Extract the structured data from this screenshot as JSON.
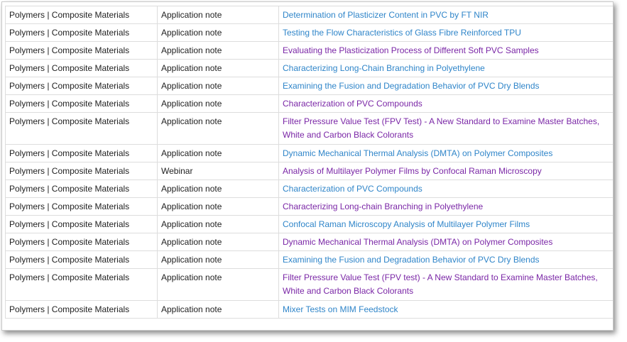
{
  "rows": [
    {
      "category": "Polymers | Composite Materials",
      "type": "Application note",
      "title": "Determination of Plasticizer Content in PVC by FT NIR",
      "visited": false
    },
    {
      "category": "Polymers | Composite Materials",
      "type": "Application note",
      "title": "Testing the Flow Characteristics of Glass Fibre Reinforced TPU",
      "visited": false
    },
    {
      "category": "Polymers | Composite Materials",
      "type": "Application note",
      "title": "Evaluating the Plasticization Process of Different Soft PVC Samples",
      "visited": true
    },
    {
      "category": "Polymers | Composite Materials",
      "type": "Application note",
      "title": "Characterizing Long-Chain Branching in Polyethylene",
      "visited": false
    },
    {
      "category": "Polymers | Composite Materials",
      "type": "Application note",
      "title": "Examining the Fusion and Degradation Behavior of PVC Dry Blends",
      "visited": false
    },
    {
      "category": "Polymers | Composite Materials",
      "type": "Application note",
      "title": "Characterization of PVC Compounds",
      "visited": true
    },
    {
      "category": "Polymers | Composite Materials",
      "type": "Application note",
      "title": "Filter Pressure Value Test (FPV Test) - A New Standard to Examine Master Batches, White and Carbon Black Colorants",
      "visited": true
    },
    {
      "category": "Polymers | Composite Materials",
      "type": "Application note",
      "title": "Dynamic Mechanical Thermal Analysis (DMTA) on Polymer Composites",
      "visited": false
    },
    {
      "category": "Polymers | Composite Materials",
      "type": "Webinar",
      "title": "Analysis of Multilayer Polymer Films by Confocal Raman Microscopy",
      "visited": true
    },
    {
      "category": "Polymers | Composite Materials",
      "type": "Application note",
      "title": "Characterization of PVC Compounds",
      "visited": false
    },
    {
      "category": "Polymers | Composite Materials",
      "type": "Application note",
      "title": "Characterizing Long-chain Branching in Polyethylene",
      "visited": true
    },
    {
      "category": "Polymers | Composite Materials",
      "type": "Application note",
      "title": "Confocal Raman Microscopy Analysis of Multilayer Polymer Films",
      "visited": false
    },
    {
      "category": "Polymers | Composite Materials",
      "type": "Application note",
      "title": "Dynamic Mechanical Thermal Analysis (DMTA) on Polymer Composites",
      "visited": true
    },
    {
      "category": "Polymers | Composite Materials",
      "type": "Application note",
      "title": "Examining the Fusion and Degradation Behavior of PVC Dry Blends",
      "visited": false
    },
    {
      "category": "Polymers | Composite Materials",
      "type": "Application note",
      "title": "Filter Pressure Value Test (FPV test) - A New Standard to Examine Master Batches, White and Carbon Black Colorants",
      "visited": true
    },
    {
      "category": "Polymers | Composite Materials",
      "type": "Application note",
      "title": "Mixer Tests on MIM Feedstock",
      "visited": false
    }
  ],
  "colors": {
    "link": "#2f85c9",
    "visited_link": "#7a26a6",
    "text": "#222222",
    "grid": "#dddddd"
  }
}
